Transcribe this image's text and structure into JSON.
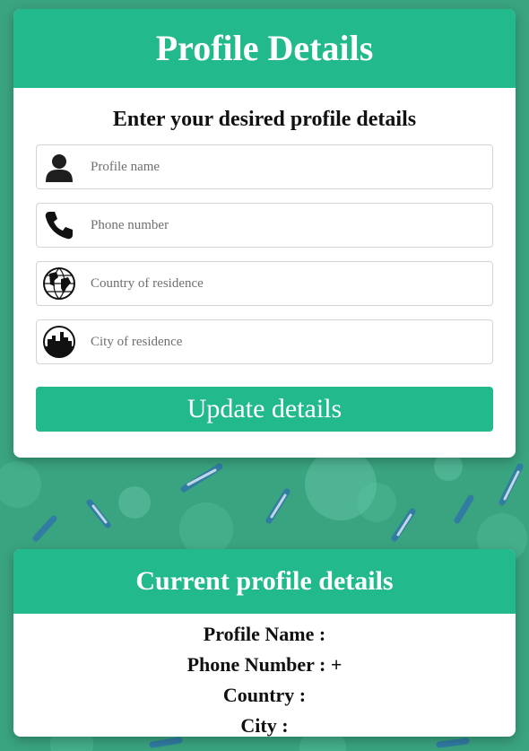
{
  "form_card": {
    "title": "Profile Details",
    "subtitle": "Enter your desired profile details",
    "fields": [
      {
        "placeholder": "Profile name",
        "value": "",
        "icon": "user-icon"
      },
      {
        "placeholder": "Phone number",
        "value": "",
        "icon": "phone-icon"
      },
      {
        "placeholder": "Country of residence",
        "value": "",
        "icon": "globe-icon"
      },
      {
        "placeholder": "City of residence",
        "value": "",
        "icon": "city-icon"
      }
    ],
    "submit_label": "Update details"
  },
  "current_card": {
    "title": "Current profile details",
    "rows": [
      {
        "label": "Profile Name : "
      },
      {
        "label": "Phone Number : +"
      },
      {
        "label": "Country : "
      },
      {
        "label": "City : "
      }
    ]
  },
  "colors": {
    "accent": "#22b98c",
    "background": "#3aa37f",
    "card": "#ffffff"
  }
}
